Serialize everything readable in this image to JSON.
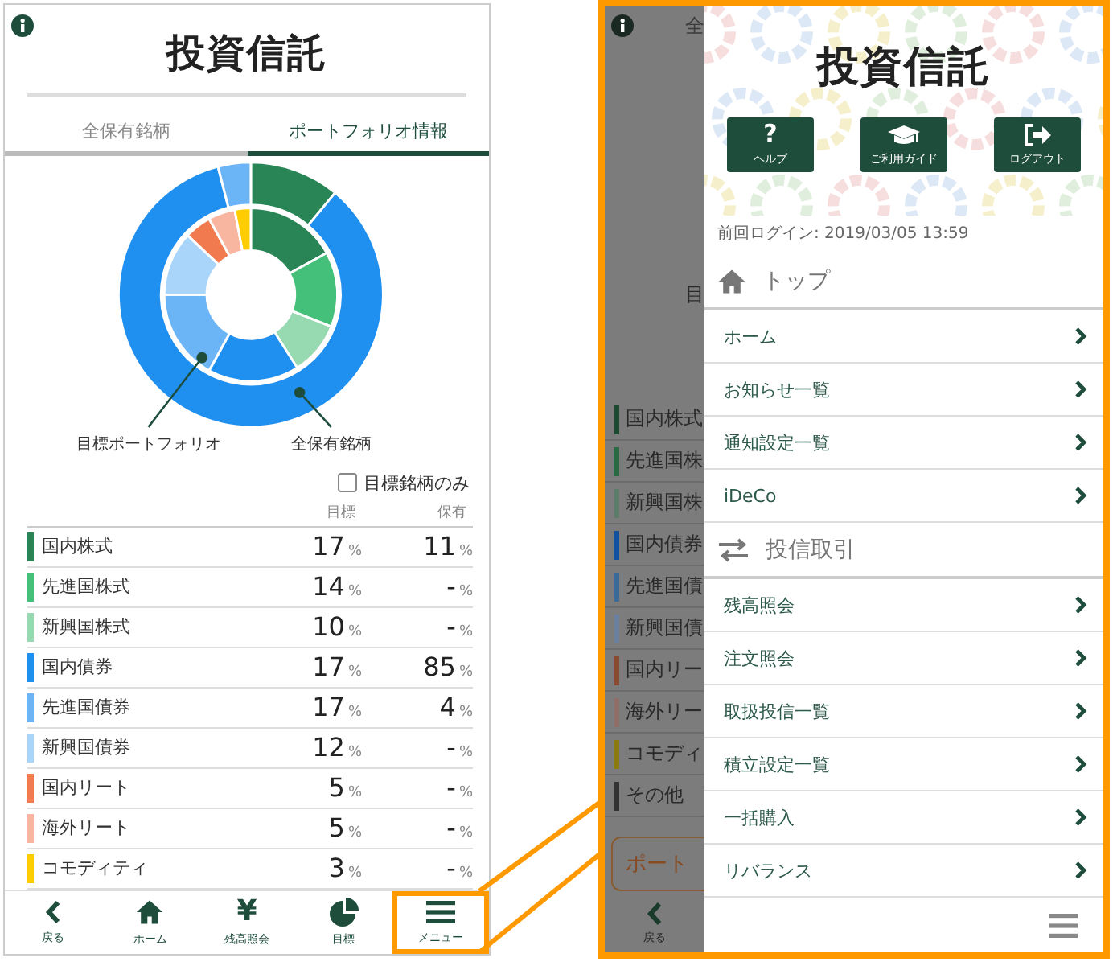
{
  "portfolio_screen": {
    "logo": "投資信託",
    "tabs": [
      {
        "label": "全保有銘柄",
        "selected": false
      },
      {
        "label": "ポートフォリオ情報",
        "selected": true
      }
    ],
    "chart": {
      "chart_data": {
        "type": "donut",
        "series": [
          {
            "name": "目標ポートフォリオ",
            "values": [
              17,
              14,
              10,
              17,
              17,
              12,
              5,
              5,
              3
            ],
            "colors": [
              "#2a8556",
              "#45c07a",
              "#97dab2",
              "#1f8ff0",
              "#6bb5f6",
              "#a9d5fb",
              "#f27a4f",
              "#f8b5a0",
              "#ffcc00"
            ]
          },
          {
            "name": "全保有銘柄",
            "values": [
              11,
              null,
              null,
              85,
              4,
              null,
              null,
              null,
              null
            ],
            "colors": [
              "#2a8556",
              null,
              null,
              "#1f8ff0",
              "#6bb5f6",
              null,
              null,
              null,
              null
            ]
          }
        ]
      }
    },
    "filter": {
      "label": "目標銘柄のみ",
      "checked": false
    },
    "table": {
      "columns": [
        "目標",
        "保有"
      ],
      "rows": [
        {
          "name": "国内株式",
          "color": "#2a8556",
          "target": "17",
          "target_unit": "%",
          "held": "11",
          "held_unit": "%"
        },
        {
          "name": "先進国株式",
          "color": "#45c07a",
          "target": "14",
          "target_unit": "%",
          "held": "-",
          "held_unit": "%"
        },
        {
          "name": "新興国株式",
          "color": "#97dab2",
          "target": "10",
          "target_unit": "%",
          "held": "-",
          "held_unit": "%"
        },
        {
          "name": "国内債券",
          "color": "#1f8ff0",
          "target": "17",
          "target_unit": "%",
          "held": "85",
          "held_unit": "%"
        },
        {
          "name": "先進国債券",
          "color": "#6bb5f6",
          "target": "17",
          "target_unit": "%",
          "held": "4",
          "held_unit": "%"
        },
        {
          "name": "新興国債券",
          "color": "#a9d5fb",
          "target": "12",
          "target_unit": "%",
          "held": "-",
          "held_unit": "%"
        },
        {
          "name": "国内リート",
          "color": "#f27a4f",
          "target": "5",
          "target_unit": "%",
          "held": "-",
          "held_unit": "%"
        },
        {
          "name": "海外リート",
          "color": "#f8b5a0",
          "target": "5",
          "target_unit": "%",
          "held": "-",
          "held_unit": "%"
        },
        {
          "name": "コモディティ",
          "color": "#ffcc00",
          "target": "3",
          "target_unit": "%",
          "held": "-",
          "held_unit": "%"
        }
      ]
    },
    "nav": [
      {
        "label": "戻る",
        "kind": "back",
        "highlighted": false
      },
      {
        "label": "ホーム",
        "kind": "home",
        "highlighted": false
      },
      {
        "label": "残高照会",
        "kind": "balance",
        "glyph": "¥",
        "highlighted": false
      },
      {
        "label": "目標",
        "kind": "target",
        "highlighted": false
      },
      {
        "label": "メニュー",
        "kind": "menu",
        "highlighted": true
      }
    ]
  },
  "menu_screen": {
    "background": {
      "tab": "全",
      "label": "目",
      "rows": [
        {
          "name": "国内株式",
          "color": "#1c4a30"
        },
        {
          "name": "先進国株",
          "color": "#2a6a42"
        },
        {
          "name": "新興国株",
          "color": "#5a7c68"
        },
        {
          "name": "国内債券",
          "color": "#1250a0"
        },
        {
          "name": "先進国債",
          "color": "#3a6a98"
        },
        {
          "name": "新興国債",
          "color": "#6a80a0"
        },
        {
          "name": "国内リー",
          "color": "#8a4a30"
        },
        {
          "name": "海外リー",
          "color": "#8e6e66"
        },
        {
          "name": "コモディ",
          "color": "#8a7a10"
        },
        {
          "name": "その他",
          "color": "#333333"
        }
      ],
      "button": "ポート",
      "back": "戻る"
    },
    "menu": {
      "logo": "投資信託",
      "buttons": [
        {
          "label": "ヘルプ",
          "kind": "help",
          "glyph": "?"
        },
        {
          "label": "ご利用ガイド",
          "kind": "guide"
        },
        {
          "label": "ログアウト",
          "kind": "logout"
        }
      ],
      "last_login": "前回ログイン: 2019/03/05 13:59",
      "sections": [
        {
          "title": "トップ",
          "kind": "home",
          "items": [
            {
              "label": "ホーム"
            },
            {
              "label": "お知らせ一覧"
            },
            {
              "label": "通知設定一覧"
            },
            {
              "label": "iDeCo"
            }
          ]
        },
        {
          "title": "投信取引",
          "kind": "trade",
          "items": [
            {
              "label": "残高照会"
            },
            {
              "label": "注文照会"
            },
            {
              "label": "取扱投信一覧"
            },
            {
              "label": "積立設定一覧"
            },
            {
              "label": "一括購入"
            },
            {
              "label": "リバランス"
            }
          ]
        }
      ]
    }
  }
}
